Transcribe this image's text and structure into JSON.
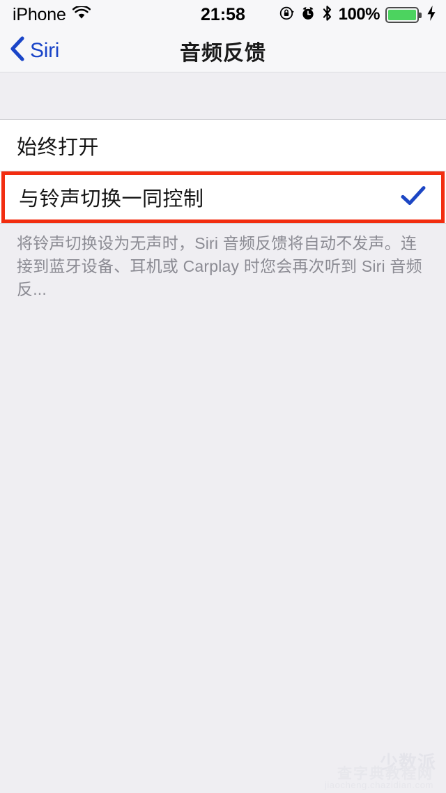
{
  "status_bar": {
    "carrier": "iPhone",
    "wifi_icon": "wifi-icon",
    "time": "21:58",
    "rotation_lock_icon": "rotation-lock-icon",
    "alarm_icon": "alarm-clock-icon",
    "bluetooth_icon": "bluetooth-icon",
    "battery_percent": "100%",
    "battery_icon": "battery-full-icon",
    "charging_icon": "lightning-bolt-icon",
    "battery_color": "#4cd35f"
  },
  "nav_bar": {
    "back_label": "Siri",
    "back_icon": "chevron-left-icon",
    "title": "音频反馈",
    "tint_color": "#1a45c8"
  },
  "list": {
    "rows": [
      {
        "label": "始终打开",
        "checked": false
      },
      {
        "label": "与铃声切换一同控制",
        "checked": true
      }
    ],
    "check_icon": "checkmark-icon",
    "check_color": "#1c46c4",
    "highlight_color": "#f22d10"
  },
  "footer": {
    "note": "将铃声切换设为无声时，Siri 音频反馈将自动不发声。连接到蓝牙设备、耳机或 Carplay 时您会再次听到 Siri 音频反..."
  },
  "watermark": {
    "brand": "少数派",
    "site": "查字典教程网",
    "url": "jiaocheng.chazidian.com"
  }
}
